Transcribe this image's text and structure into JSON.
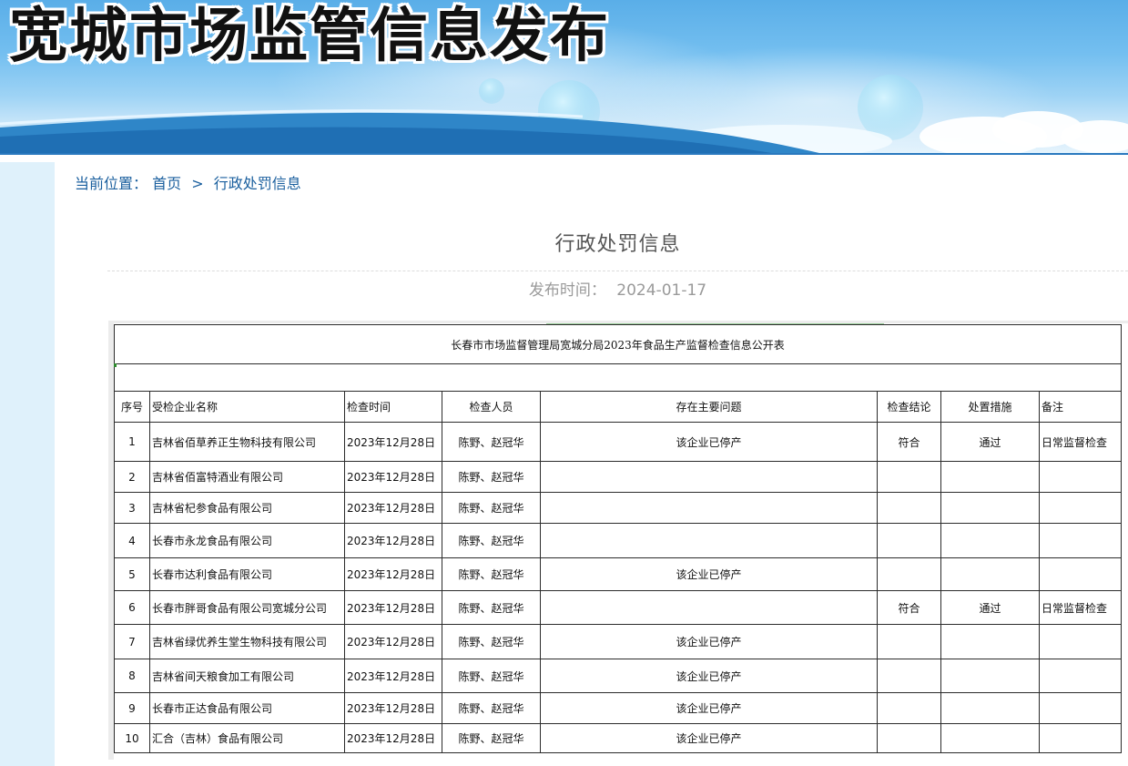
{
  "banner": {
    "title": "宽城市场监管信息发布"
  },
  "breadcrumb": {
    "label": "当前位置：",
    "home": "首页",
    "separator": ">",
    "current": "行政处罚信息"
  },
  "article": {
    "title": "行政处罚信息",
    "publish_label": "发布时间：",
    "publish_date": "2024-01-17"
  },
  "table": {
    "title": "长春市市场监督管理局宽城分局2023年食品生产监督检查信息公开表",
    "headers": [
      "序号",
      "受检企业名称",
      "检查时间",
      "检查人员",
      "存在主要问题",
      "检查结论",
      "处置措施",
      "备注"
    ],
    "rows": [
      {
        "no": "1",
        "company": "吉林省佰草养正生物科技有限公司",
        "date": "2023年12月28日",
        "inspectors": "陈野、赵冠华",
        "issue": "该企业已停产",
        "conclusion": "符合",
        "measure": "通过",
        "remark": "日常监督检查"
      },
      {
        "no": "2",
        "company": "吉林省佰富特酒业有限公司",
        "date": "2023年12月28日",
        "inspectors": "陈野、赵冠华",
        "issue": "",
        "conclusion": "",
        "measure": "",
        "remark": ""
      },
      {
        "no": "3",
        "company": "吉林省杞参食品有限公司",
        "date": "2023年12月28日",
        "inspectors": "陈野、赵冠华",
        "issue": "",
        "conclusion": "",
        "measure": "",
        "remark": ""
      },
      {
        "no": "4",
        "company": "长春市永龙食品有限公司",
        "date": "2023年12月28日",
        "inspectors": "陈野、赵冠华",
        "issue": "",
        "conclusion": "",
        "measure": "",
        "remark": ""
      },
      {
        "no": "5",
        "company": "长春市达利食品有限公司",
        "date": "2023年12月28日",
        "inspectors": "陈野、赵冠华",
        "issue": "该企业已停产",
        "conclusion": "",
        "measure": "",
        "remark": ""
      },
      {
        "no": "6",
        "company": "长春市胖哥食品有限公司宽城分公司",
        "date": "2023年12月28日",
        "inspectors": "陈野、赵冠华",
        "issue": "",
        "conclusion": "符合",
        "measure": "通过",
        "remark": "日常监督检查"
      },
      {
        "no": "7",
        "company": "吉林省绿优养生堂生物科技有限公司",
        "date": "2023年12月28日",
        "inspectors": "陈野、赵冠华",
        "issue": "该企业已停产",
        "conclusion": "",
        "measure": "",
        "remark": ""
      },
      {
        "no": "8",
        "company": "吉林省间天粮食加工有限公司",
        "date": "2023年12月28日",
        "inspectors": "陈野、赵冠华",
        "issue": "该企业已停产",
        "conclusion": "",
        "measure": "",
        "remark": ""
      },
      {
        "no": "9",
        "company": "长春市正达食品有限公司",
        "date": "2023年12月28日",
        "inspectors": "陈野、赵冠华",
        "issue": "该企业已停产",
        "conclusion": "",
        "measure": "",
        "remark": ""
      },
      {
        "no": "10",
        "company": "汇合（吉林）食品有限公司",
        "date": "2023年12月28日",
        "inspectors": "陈野、赵冠华",
        "issue": "该企业已停产",
        "conclusion": "",
        "measure": "",
        "remark": ""
      }
    ]
  },
  "colors": {
    "link": "#1a5f9e",
    "sidebar": "#dff1fb",
    "banner_sky": "#5aaee8",
    "muted_text": "#9a9a9a"
  }
}
